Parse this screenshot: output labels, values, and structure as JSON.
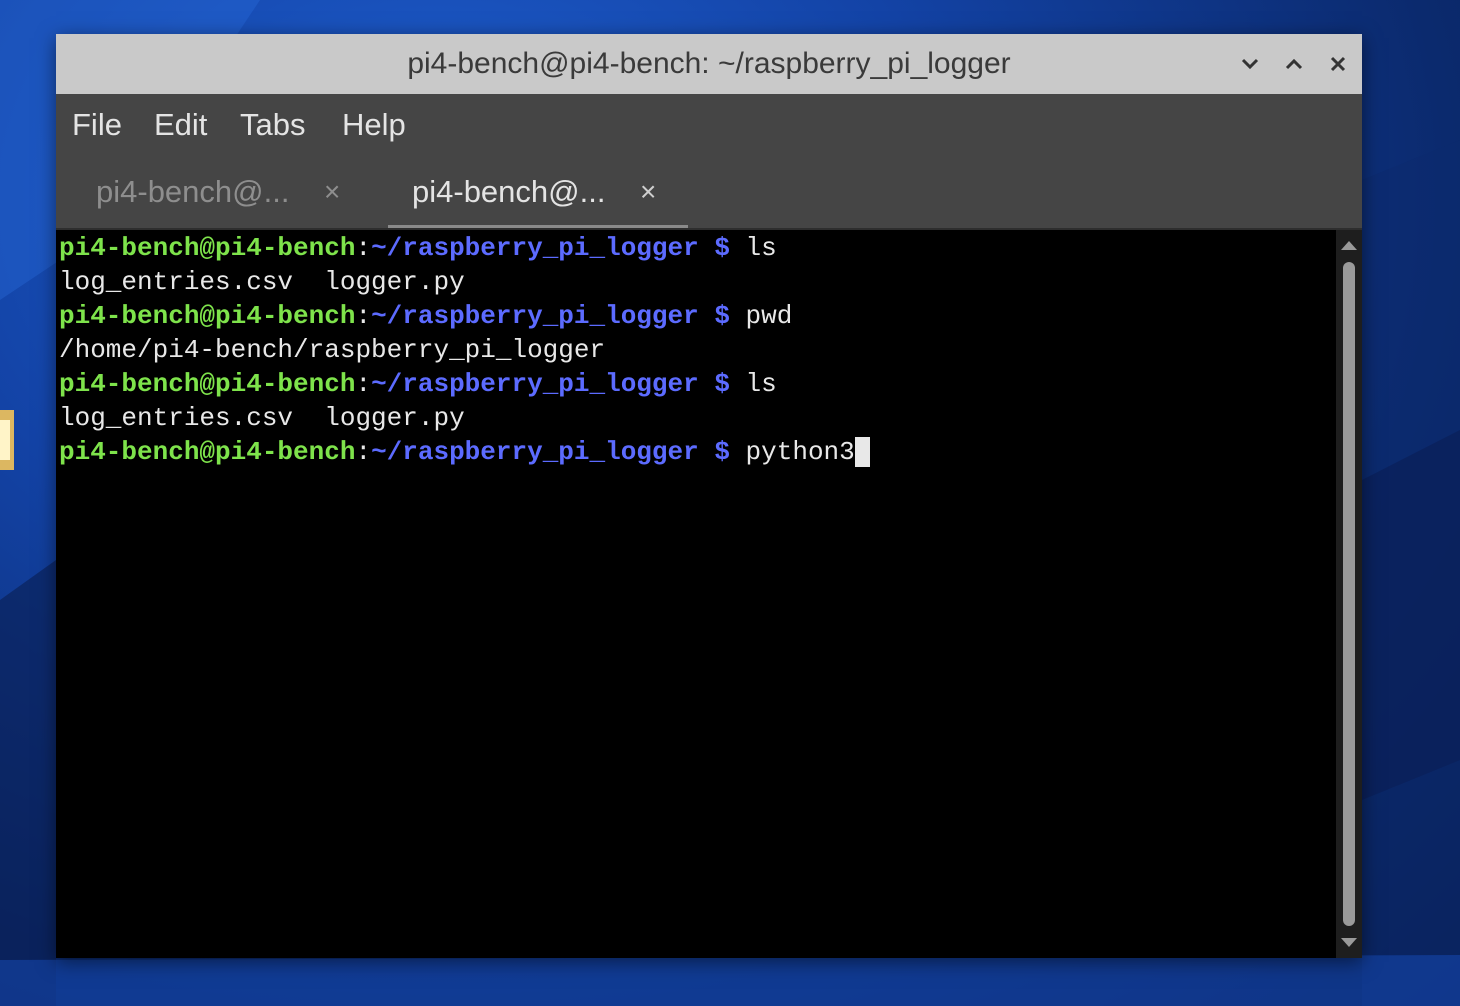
{
  "window": {
    "title": "pi4-bench@pi4-bench: ~/raspberry_pi_logger"
  },
  "menu": {
    "items": [
      "File",
      "Edit",
      "Tabs",
      "Help"
    ]
  },
  "tabs": [
    {
      "label": "pi4-bench@...",
      "close": "×",
      "active": false
    },
    {
      "label": "pi4-bench@...",
      "close": "×",
      "active": true
    }
  ],
  "terminal": {
    "prompt_user": "pi4-bench@pi4-bench",
    "prompt_colon": ":",
    "prompt_path": "~/raspberry_pi_logger",
    "prompt_symbol": " $ ",
    "lines": [
      {
        "type": "prompt",
        "command": "ls"
      },
      {
        "type": "output",
        "text": "log_entries.csv  logger.py"
      },
      {
        "type": "prompt",
        "command": "pwd"
      },
      {
        "type": "output",
        "text": "/home/pi4-bench/raspberry_pi_logger"
      },
      {
        "type": "prompt",
        "command": "ls"
      },
      {
        "type": "output",
        "text": "log_entries.csv  logger.py"
      },
      {
        "type": "prompt",
        "command": "python3"
      }
    ]
  },
  "colors": {
    "prompt_user": "#7ee34b",
    "prompt_path": "#5c6bff",
    "text": "#e8e8e8",
    "terminal_bg": "#000000",
    "titlebar_bg": "#c9c9c9",
    "menubar_bg": "#454545"
  },
  "icons": {
    "minimize": "chevron-down-icon",
    "maximize": "chevron-up-icon",
    "close": "close-icon"
  }
}
